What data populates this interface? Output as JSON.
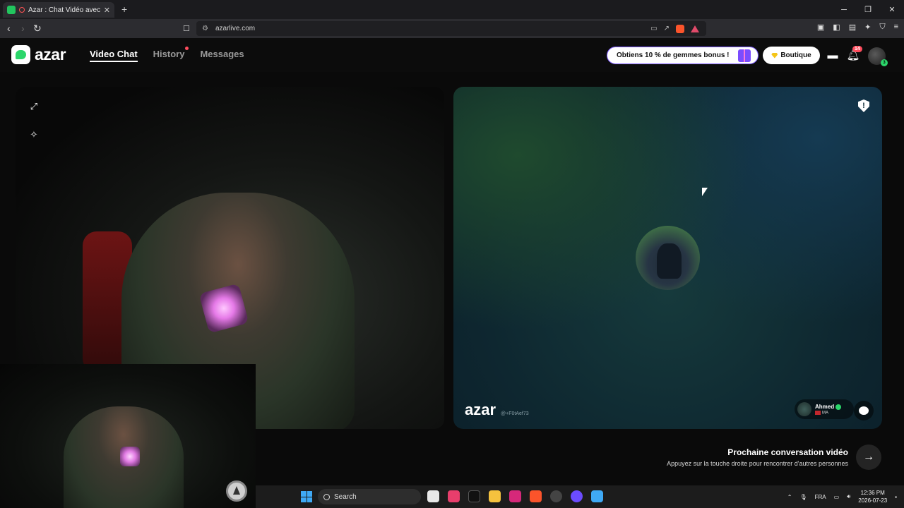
{
  "browser": {
    "tab_title": "Azar : Chat Vidéo avec de no",
    "tab_close": "✕",
    "new_tab": "+",
    "url": "azarlive.com",
    "window_controls": [
      "─",
      "❐",
      "✕"
    ],
    "brave_count": "3"
  },
  "header": {
    "logo_text": "azar",
    "nav": [
      "Video Chat",
      "History",
      "Messages"
    ],
    "promo_text": "Obtiens 10 % de gemmes bonus !",
    "shop_label": "Boutique",
    "notification_count": "14",
    "avatar_badge": "3"
  },
  "peer_panel": {
    "report_icon": "!",
    "watermark": "azar",
    "watermark_id": "@+F0tAef73",
    "user_name": "Ahmed",
    "country_code": "MA"
  },
  "next": {
    "title": "Prochaine conversation vidéo",
    "subtitle": "Appuyez sur la touche droite pour rencontrer d'autres personnes",
    "arrow": "→"
  },
  "taskbar": {
    "search_label": "Search",
    "lang": "FRA",
    "time": "12:36 PM",
    "date": "2026-07-23"
  },
  "icons": {
    "expand": "expand-icon",
    "magic": "magic-wand-icon",
    "shield": "shield-report-icon",
    "chat": "chat-bubble-icon",
    "next": "arrow-right-icon"
  }
}
